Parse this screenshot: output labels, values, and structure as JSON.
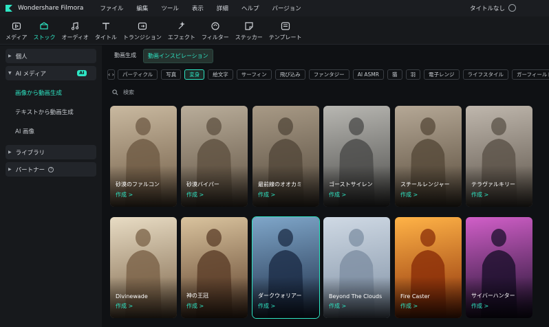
{
  "app": {
    "name": "Wondershare Filmora",
    "doc_title": "タイトルなし"
  },
  "menus": [
    "ファイル",
    "編集",
    "ツール",
    "表示",
    "詳細",
    "ヘルプ",
    "バージョン"
  ],
  "toolbar": [
    {
      "label": "メディア",
      "icon": "media-icon"
    },
    {
      "label": "ストック",
      "icon": "stock-icon",
      "active": true
    },
    {
      "label": "オーディオ",
      "icon": "audio-icon"
    },
    {
      "label": "タイトル",
      "icon": "title-icon"
    },
    {
      "label": "トランジション",
      "icon": "transition-icon"
    },
    {
      "label": "エフェクト",
      "icon": "effect-icon"
    },
    {
      "label": "フィルター",
      "icon": "filter-icon"
    },
    {
      "label": "ステッカー",
      "icon": "sticker-icon"
    },
    {
      "label": "テンプレート",
      "icon": "template-icon"
    }
  ],
  "sidebar": {
    "personal": "個人",
    "ai_media": "AI メディア",
    "ai_badge": "AI",
    "sub": [
      "画像から動画生成",
      "テキストから動画生成",
      "AI 画像"
    ],
    "library": "ライブラリ",
    "partner": "パートナー",
    "partner_help": "?"
  },
  "tabs": [
    "動画生成",
    "動画インスピレーション"
  ],
  "chip_nav": "‹ ›",
  "chips": [
    "パーティクル",
    "写真",
    "変身",
    "絵文字",
    "サーフィン",
    "飛び込み",
    "ファンタジー",
    "AI ASMR",
    "猫",
    "羽",
    "電子レンジ",
    "ライフスタイル",
    "ガーフィールド"
  ],
  "search_placeholder": "検索",
  "cards": [
    {
      "name": "砂漠のファルコン",
      "action": "作成 >",
      "palette": [
        "#c9b9a0",
        "#6e5a44"
      ]
    },
    {
      "name": "砂漠バイパー",
      "action": "作成 >",
      "palette": [
        "#b9ad9a",
        "#5e5040"
      ]
    },
    {
      "name": "最前線のオオカミ",
      "action": "作成 >",
      "palette": [
        "#a89a86",
        "#52473a"
      ]
    },
    {
      "name": "ゴーストサイレン",
      "action": "作成 >",
      "palette": [
        "#b8b7b2",
        "#4a4a48"
      ]
    },
    {
      "name": "スチールレンジャー",
      "action": "作成 >",
      "palette": [
        "#b5a896",
        "#554838"
      ]
    },
    {
      "name": "テラヴァルキリー",
      "action": "作成 >",
      "palette": [
        "#bfb7ad",
        "#5a5147"
      ]
    },
    {
      "name": "Divinewade",
      "action": "作成 >",
      "palette": [
        "#e8dcc4",
        "#7a6247"
      ]
    },
    {
      "name": "神の王冠",
      "action": "作成 >",
      "palette": [
        "#d9c39e",
        "#5b3d28"
      ]
    },
    {
      "name": "ダークウォリアー",
      "action": "作成 >",
      "palette": [
        "#7fa6c9",
        "#1c2c46"
      ]
    },
    {
      "name": "Beyond The Clouds",
      "action": "作成 >",
      "palette": [
        "#cfd9e4",
        "#7e8fa3"
      ]
    },
    {
      "name": "Fire Caster",
      "action": "作成 >",
      "palette": [
        "#ffb347",
        "#8a2d08"
      ]
    },
    {
      "name": "サイバーハンター",
      "action": "作成 >",
      "palette": [
        "#d15fc8",
        "#1a0f2b"
      ]
    }
  ]
}
